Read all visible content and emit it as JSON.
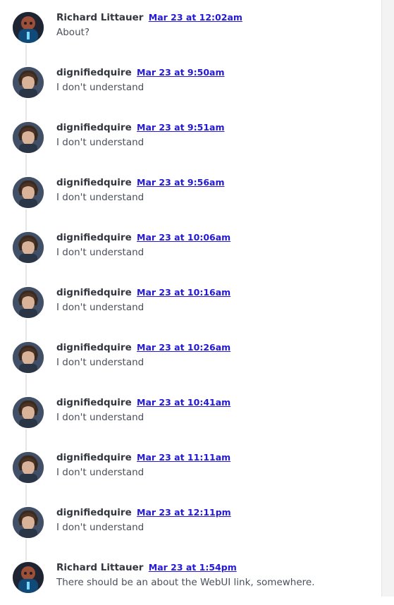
{
  "comments": [
    {
      "author": "Richard Littauer",
      "date": "Mar 23 at 12:02am",
      "body": "About?",
      "avatar": "avatar-richard"
    },
    {
      "author": "dignifiedquire",
      "date": "Mar 23 at 9:50am",
      "body": "I don't understand",
      "avatar": "avatar-dignifiedquire"
    },
    {
      "author": "dignifiedquire",
      "date": "Mar 23 at 9:51am",
      "body": "I don't understand",
      "avatar": "avatar-dignifiedquire"
    },
    {
      "author": "dignifiedquire",
      "date": "Mar 23 at 9:56am",
      "body": "I don't understand",
      "avatar": "avatar-dignifiedquire"
    },
    {
      "author": "dignifiedquire",
      "date": "Mar 23 at 10:06am",
      "body": "I don't understand",
      "avatar": "avatar-dignifiedquire"
    },
    {
      "author": "dignifiedquire",
      "date": "Mar 23 at 10:16am",
      "body": "I don't understand",
      "avatar": "avatar-dignifiedquire"
    },
    {
      "author": "dignifiedquire",
      "date": "Mar 23 at 10:26am",
      "body": "I don't understand",
      "avatar": "avatar-dignifiedquire"
    },
    {
      "author": "dignifiedquire",
      "date": "Mar 23 at 10:41am",
      "body": "I don't understand",
      "avatar": "avatar-dignifiedquire"
    },
    {
      "author": "dignifiedquire",
      "date": "Mar 23 at 11:11am",
      "body": "I don't understand",
      "avatar": "avatar-dignifiedquire"
    },
    {
      "author": "dignifiedquire",
      "date": "Mar 23 at 12:11pm",
      "body": "I don't understand",
      "avatar": "avatar-dignifiedquire"
    },
    {
      "author": "Richard Littauer",
      "date": "Mar 23 at 1:54pm",
      "body": "There should be an about the WebUI link, somewhere.",
      "avatar": "avatar-richard"
    }
  ],
  "colors": {
    "link": "#2319d6",
    "author": "#34373f",
    "body": "#4a4f59",
    "rail": "#e6e6e6"
  }
}
